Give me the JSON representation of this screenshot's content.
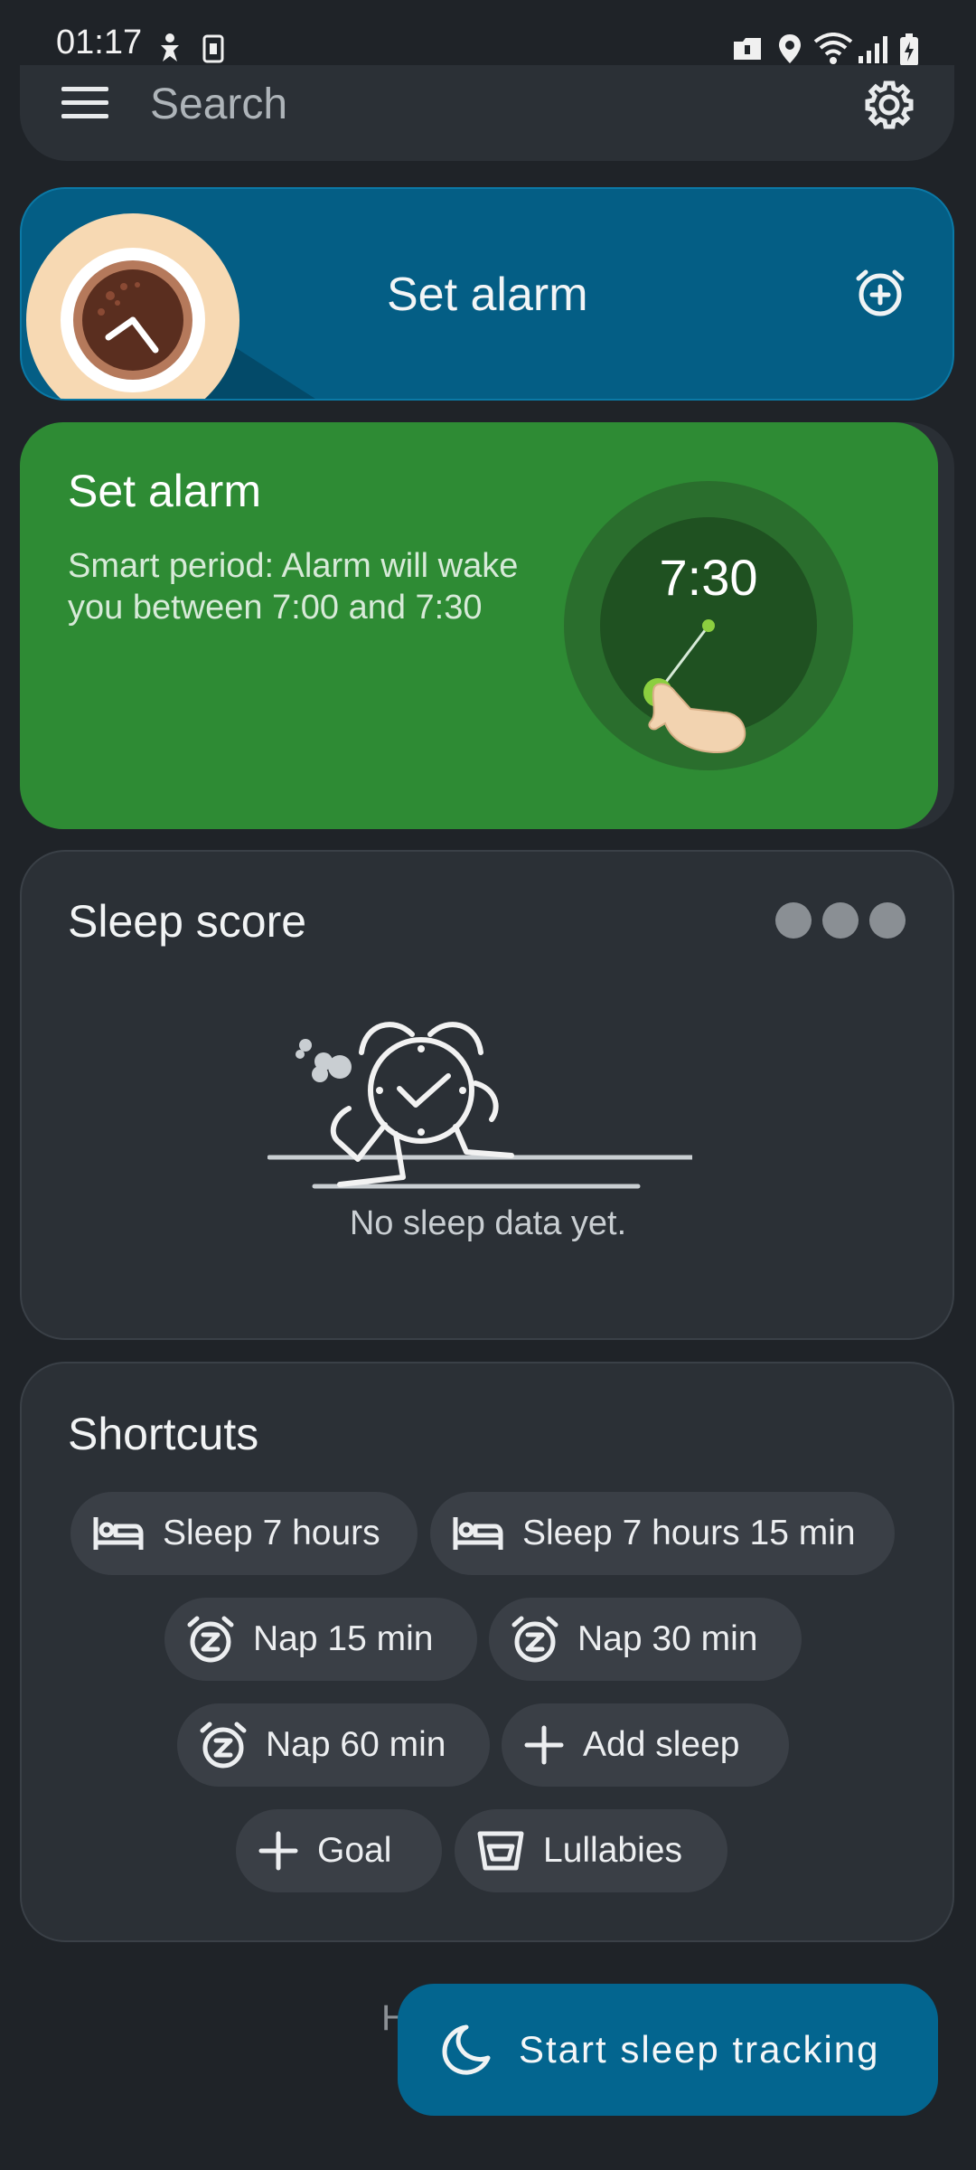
{
  "status_bar": {
    "time": "01:17"
  },
  "search": {
    "placeholder": "Search"
  },
  "banner": {
    "title": "Set alarm"
  },
  "alarm_card": {
    "title": "Set alarm",
    "subtitle": "Smart period: Alarm will wake you between 7:00 and 7:30",
    "clock_time": "7:30"
  },
  "sleep_score": {
    "title": "Sleep score",
    "empty_text": "No sleep data yet."
  },
  "shortcuts": {
    "title": "Shortcuts",
    "items": [
      {
        "label": "Sleep 7 hours",
        "icon": "bed-icon"
      },
      {
        "label": "Sleep 7 hours 15 min",
        "icon": "bed-icon"
      },
      {
        "label": "Nap 15 min",
        "icon": "snooze-alarm-icon"
      },
      {
        "label": "Nap 30 min",
        "icon": "snooze-alarm-icon"
      },
      {
        "label": "Nap 60 min",
        "icon": "snooze-alarm-icon"
      },
      {
        "label": "Add sleep",
        "icon": "plus-icon"
      },
      {
        "label": "Goal",
        "icon": "plus-icon"
      },
      {
        "label": "Lullabies",
        "icon": "lullaby-icon"
      }
    ]
  },
  "bottom": {
    "peek_text": "H",
    "fab_label": "Start sleep tracking"
  },
  "colors": {
    "background": "#1f2328",
    "banner": "#045e85",
    "alarm_card": "#2e8b34",
    "fab": "#03658f"
  }
}
